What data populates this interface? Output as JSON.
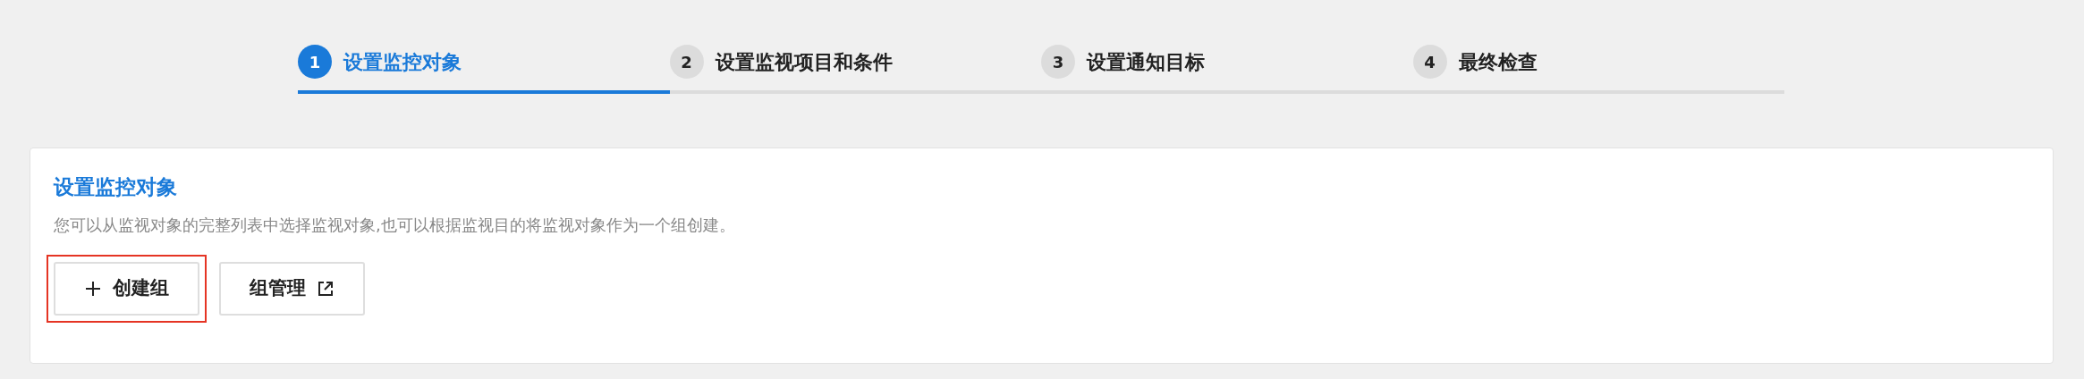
{
  "steps": [
    {
      "number": "1",
      "label": "设置监控对象",
      "selected": true
    },
    {
      "number": "2",
      "label": "设置监视项目和条件",
      "selected": false
    },
    {
      "number": "3",
      "label": "设置通知目标",
      "selected": false
    },
    {
      "number": "4",
      "label": "最终检查",
      "selected": false
    }
  ],
  "panel": {
    "title": "设置监控对象",
    "description": "您可以从监视对象的完整列表中选择监视对象,也可以根据监视目的将监视对象作为一个组创建。",
    "buttons": [
      {
        "kind": "add",
        "label": "创建组",
        "highlighted": true
      },
      {
        "kind": "external",
        "label": "组管理",
        "highlighted": false
      }
    ]
  }
}
